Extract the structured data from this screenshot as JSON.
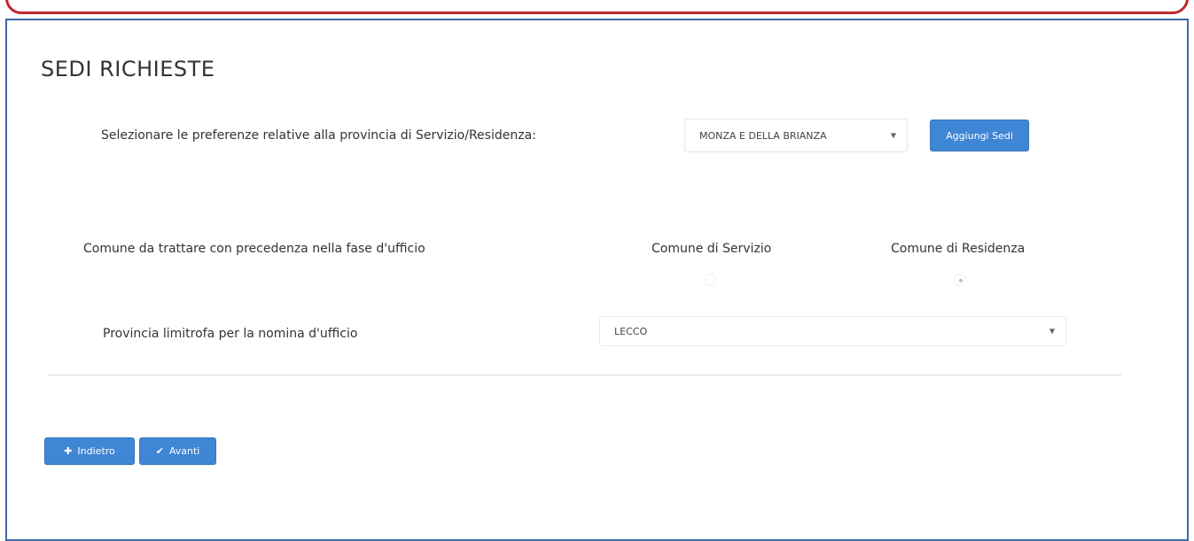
{
  "section": {
    "title": "SEDI RICHIESTE"
  },
  "preferences": {
    "label": "Selezionare le preferenze relative alla provincia di Servizio/Residenza:",
    "province_selected": "MONZA E DELLA BRIANZA",
    "add_button_label": "Aggiungi Sedi"
  },
  "priority": {
    "label": "Comune da trattare con precedenza nella fase d'ufficio",
    "option_service_label": "Comune di Servizio",
    "option_residence_label": "Comune di Residenza",
    "selected": "Comune di Residenza"
  },
  "neighbor": {
    "label": "Provincia limitrofa per la nomina d'ufficio",
    "selected": "LECCO"
  },
  "footer": {
    "back_label": "Indietro",
    "next_label": "Avanti"
  },
  "icons": {
    "select_chevron": "▼",
    "back_icon": "✚",
    "next_icon": "✔"
  },
  "colors": {
    "primary": "#3f86d4",
    "frame_border": "#3c6aa6",
    "callout_border": "#c0282d"
  }
}
